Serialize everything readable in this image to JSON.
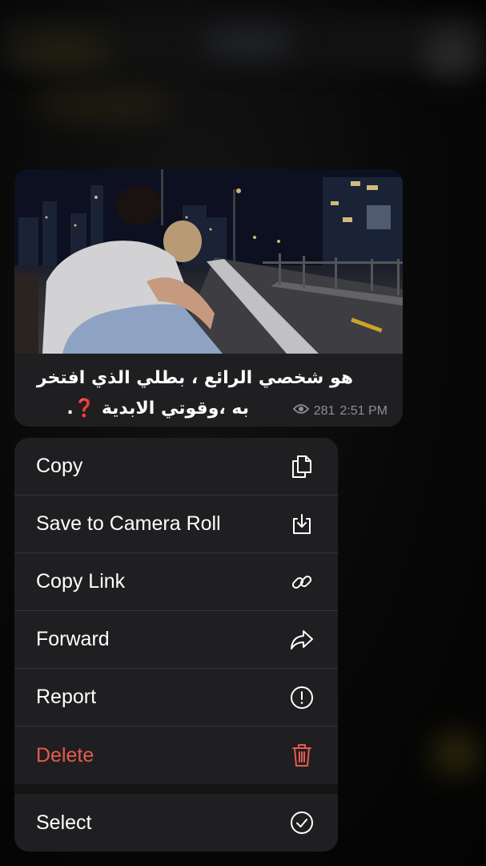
{
  "message": {
    "caption_line1": "هو شخصي الرائع ، بطلي الذي افتخر",
    "caption_line2": "به ،وقوتي الابدية ❓.",
    "views": "281",
    "time": "2:51 PM"
  },
  "menu": {
    "items": [
      {
        "label": "Copy",
        "icon": "copy-icon"
      },
      {
        "label": "Save to Camera Roll",
        "icon": "save-download-icon"
      },
      {
        "label": "Copy Link",
        "icon": "link-icon"
      },
      {
        "label": "Forward",
        "icon": "forward-arrow-icon"
      },
      {
        "label": "Report",
        "icon": "exclamation-circle-icon"
      },
      {
        "label": "Delete",
        "icon": "trash-icon"
      },
      {
        "label": "Select",
        "icon": "checkmark-circle-icon"
      }
    ]
  },
  "colors": {
    "menu_background": "#1f1f21",
    "destructive": "#e65a4e",
    "meta_text": "#8e8e93"
  }
}
